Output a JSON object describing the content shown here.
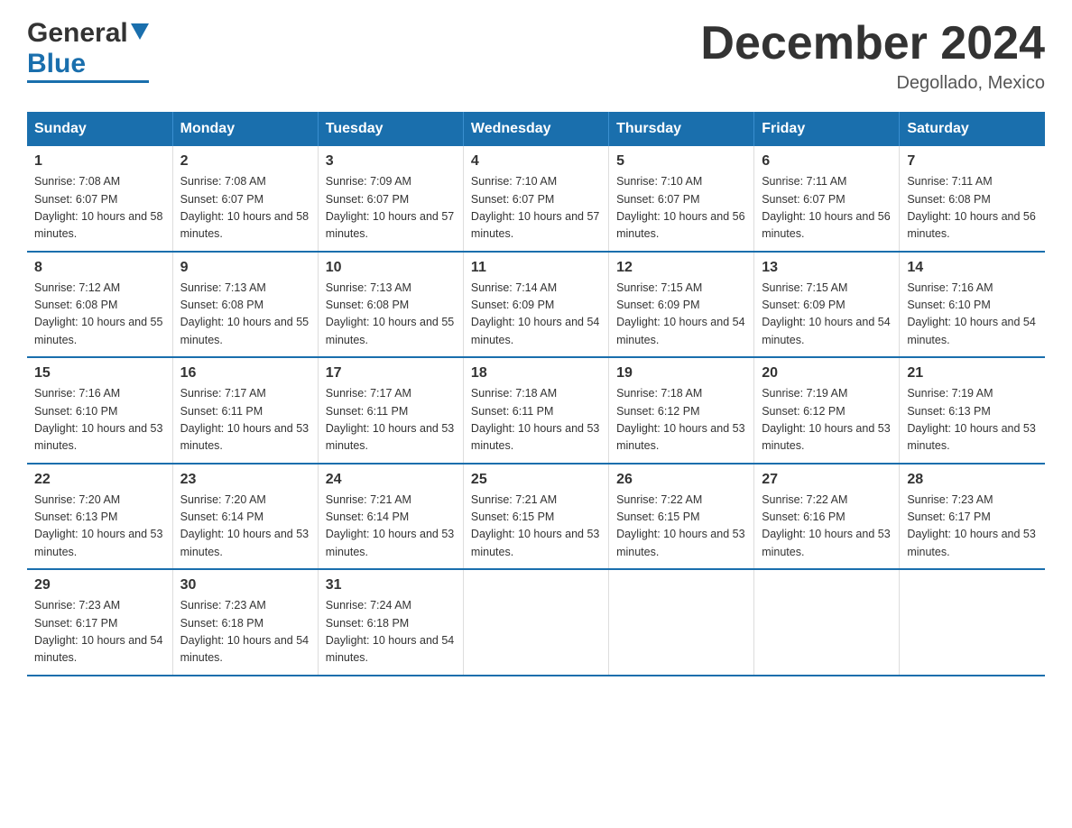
{
  "header": {
    "title": "December 2024",
    "location": "Degollado, Mexico",
    "logo_general": "General",
    "logo_blue": "Blue"
  },
  "days_of_week": [
    "Sunday",
    "Monday",
    "Tuesday",
    "Wednesday",
    "Thursday",
    "Friday",
    "Saturday"
  ],
  "weeks": [
    [
      {
        "day": "1",
        "sunrise": "7:08 AM",
        "sunset": "6:07 PM",
        "daylight": "10 hours and 58 minutes."
      },
      {
        "day": "2",
        "sunrise": "7:08 AM",
        "sunset": "6:07 PM",
        "daylight": "10 hours and 58 minutes."
      },
      {
        "day": "3",
        "sunrise": "7:09 AM",
        "sunset": "6:07 PM",
        "daylight": "10 hours and 57 minutes."
      },
      {
        "day": "4",
        "sunrise": "7:10 AM",
        "sunset": "6:07 PM",
        "daylight": "10 hours and 57 minutes."
      },
      {
        "day": "5",
        "sunrise": "7:10 AM",
        "sunset": "6:07 PM",
        "daylight": "10 hours and 56 minutes."
      },
      {
        "day": "6",
        "sunrise": "7:11 AM",
        "sunset": "6:07 PM",
        "daylight": "10 hours and 56 minutes."
      },
      {
        "day": "7",
        "sunrise": "7:11 AM",
        "sunset": "6:08 PM",
        "daylight": "10 hours and 56 minutes."
      }
    ],
    [
      {
        "day": "8",
        "sunrise": "7:12 AM",
        "sunset": "6:08 PM",
        "daylight": "10 hours and 55 minutes."
      },
      {
        "day": "9",
        "sunrise": "7:13 AM",
        "sunset": "6:08 PM",
        "daylight": "10 hours and 55 minutes."
      },
      {
        "day": "10",
        "sunrise": "7:13 AM",
        "sunset": "6:08 PM",
        "daylight": "10 hours and 55 minutes."
      },
      {
        "day": "11",
        "sunrise": "7:14 AM",
        "sunset": "6:09 PM",
        "daylight": "10 hours and 54 minutes."
      },
      {
        "day": "12",
        "sunrise": "7:15 AM",
        "sunset": "6:09 PM",
        "daylight": "10 hours and 54 minutes."
      },
      {
        "day": "13",
        "sunrise": "7:15 AM",
        "sunset": "6:09 PM",
        "daylight": "10 hours and 54 minutes."
      },
      {
        "day": "14",
        "sunrise": "7:16 AM",
        "sunset": "6:10 PM",
        "daylight": "10 hours and 54 minutes."
      }
    ],
    [
      {
        "day": "15",
        "sunrise": "7:16 AM",
        "sunset": "6:10 PM",
        "daylight": "10 hours and 53 minutes."
      },
      {
        "day": "16",
        "sunrise": "7:17 AM",
        "sunset": "6:11 PM",
        "daylight": "10 hours and 53 minutes."
      },
      {
        "day": "17",
        "sunrise": "7:17 AM",
        "sunset": "6:11 PM",
        "daylight": "10 hours and 53 minutes."
      },
      {
        "day": "18",
        "sunrise": "7:18 AM",
        "sunset": "6:11 PM",
        "daylight": "10 hours and 53 minutes."
      },
      {
        "day": "19",
        "sunrise": "7:18 AM",
        "sunset": "6:12 PM",
        "daylight": "10 hours and 53 minutes."
      },
      {
        "day": "20",
        "sunrise": "7:19 AM",
        "sunset": "6:12 PM",
        "daylight": "10 hours and 53 minutes."
      },
      {
        "day": "21",
        "sunrise": "7:19 AM",
        "sunset": "6:13 PM",
        "daylight": "10 hours and 53 minutes."
      }
    ],
    [
      {
        "day": "22",
        "sunrise": "7:20 AM",
        "sunset": "6:13 PM",
        "daylight": "10 hours and 53 minutes."
      },
      {
        "day": "23",
        "sunrise": "7:20 AM",
        "sunset": "6:14 PM",
        "daylight": "10 hours and 53 minutes."
      },
      {
        "day": "24",
        "sunrise": "7:21 AM",
        "sunset": "6:14 PM",
        "daylight": "10 hours and 53 minutes."
      },
      {
        "day": "25",
        "sunrise": "7:21 AM",
        "sunset": "6:15 PM",
        "daylight": "10 hours and 53 minutes."
      },
      {
        "day": "26",
        "sunrise": "7:22 AM",
        "sunset": "6:15 PM",
        "daylight": "10 hours and 53 minutes."
      },
      {
        "day": "27",
        "sunrise": "7:22 AM",
        "sunset": "6:16 PM",
        "daylight": "10 hours and 53 minutes."
      },
      {
        "day": "28",
        "sunrise": "7:23 AM",
        "sunset": "6:17 PM",
        "daylight": "10 hours and 53 minutes."
      }
    ],
    [
      {
        "day": "29",
        "sunrise": "7:23 AM",
        "sunset": "6:17 PM",
        "daylight": "10 hours and 54 minutes."
      },
      {
        "day": "30",
        "sunrise": "7:23 AM",
        "sunset": "6:18 PM",
        "daylight": "10 hours and 54 minutes."
      },
      {
        "day": "31",
        "sunrise": "7:24 AM",
        "sunset": "6:18 PM",
        "daylight": "10 hours and 54 minutes."
      },
      null,
      null,
      null,
      null
    ]
  ]
}
